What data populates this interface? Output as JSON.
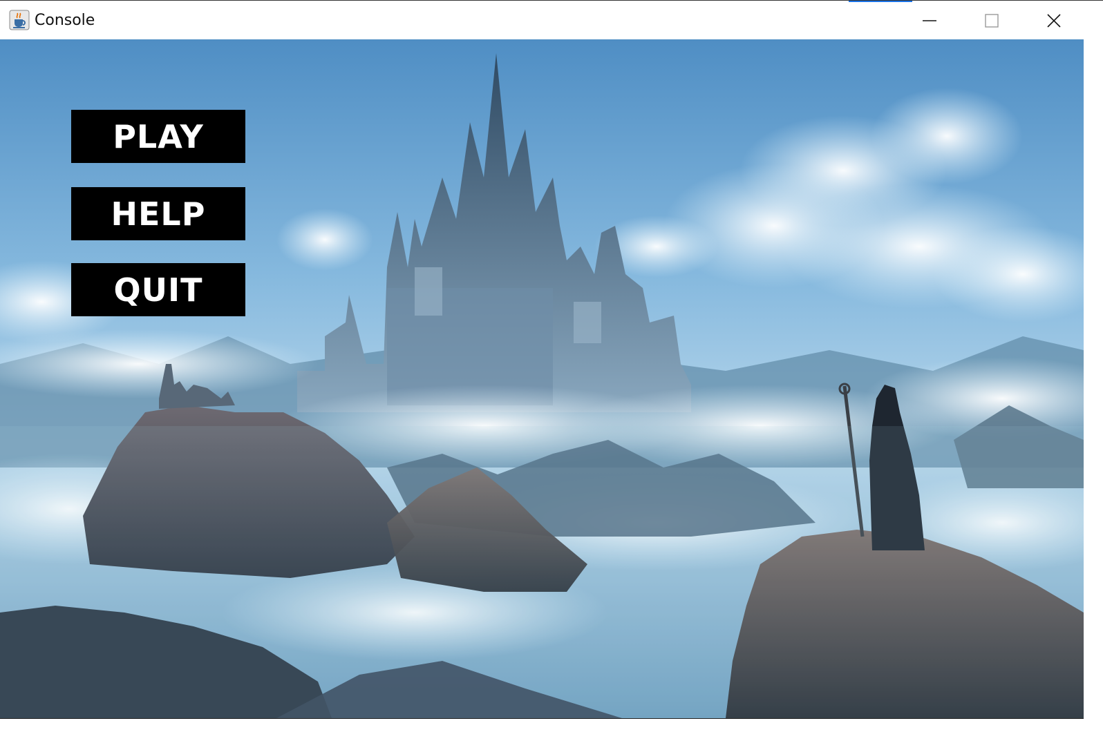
{
  "window": {
    "title": "Console",
    "app_icon": "java-cup-icon",
    "controls": {
      "minimize_icon": "minimize-icon",
      "maximize_icon": "maximize-icon",
      "close_icon": "close-icon"
    }
  },
  "menu": {
    "play_label": "PLAY",
    "help_label": "HELP",
    "quit_label": "QUIT"
  },
  "colors": {
    "button_bg": "#000000",
    "button_text": "#ffffff",
    "sky": "#7fb3d8",
    "accent": "#1a73e8"
  }
}
